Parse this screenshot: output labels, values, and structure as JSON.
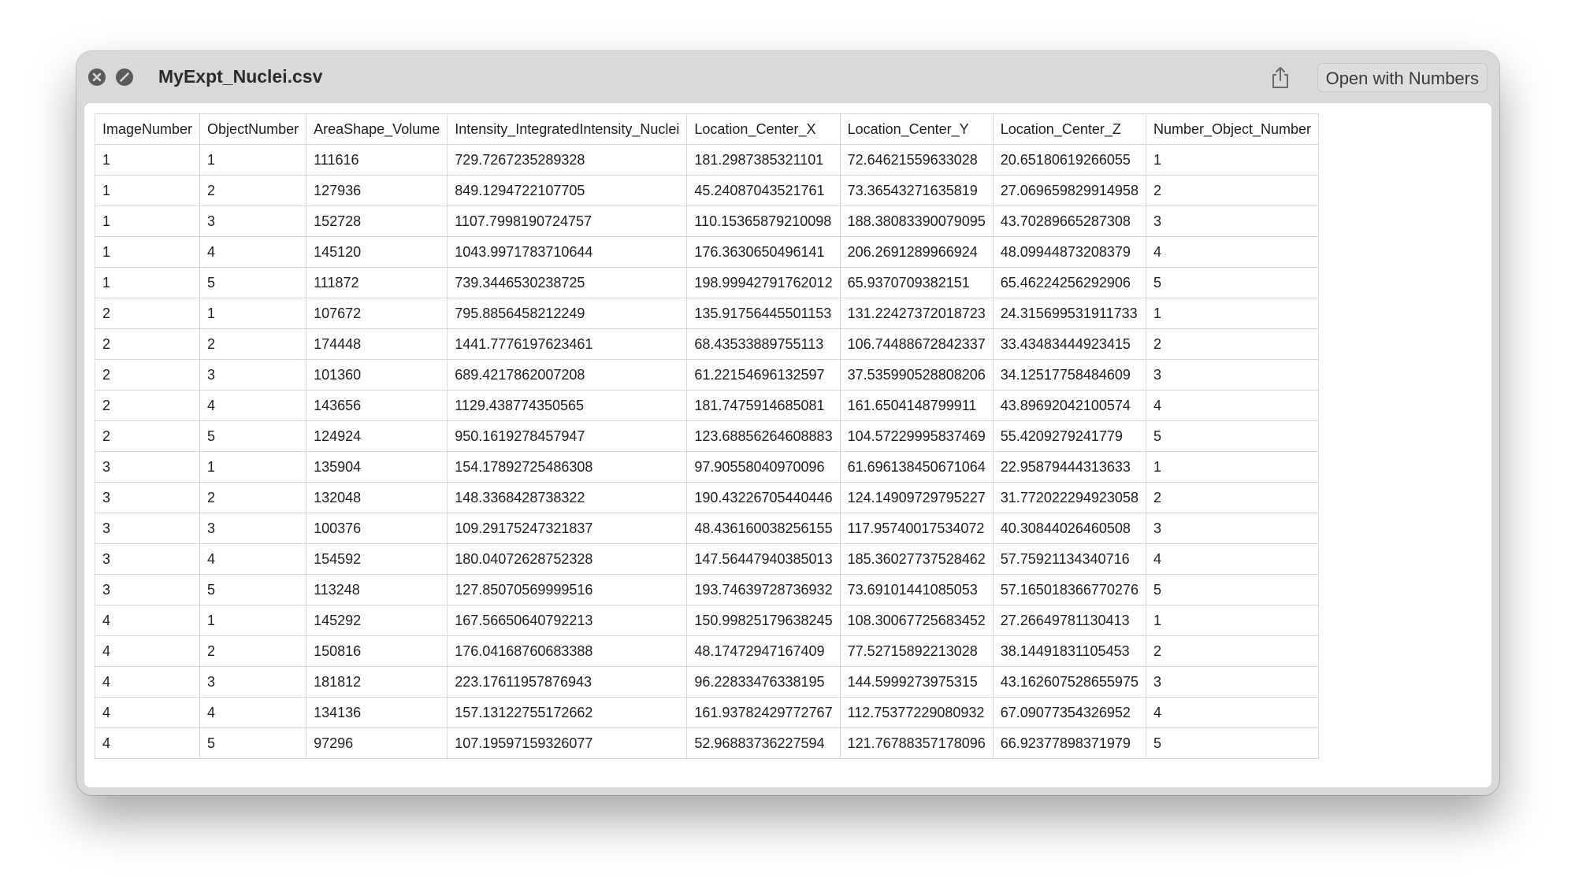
{
  "window": {
    "title": "MyExpt_Nuclei.csv",
    "open_button_label": "Open with Numbers"
  },
  "table": {
    "columns": [
      "ImageNumber",
      "ObjectNumber",
      "AreaShape_Volume",
      "Intensity_IntegratedIntensity_Nuclei",
      "Location_Center_X",
      "Location_Center_Y",
      "Location_Center_Z",
      "Number_Object_Number"
    ],
    "rows": [
      [
        "1",
        "1",
        "111616",
        "729.7267235289328",
        "181.2987385321101",
        "72.64621559633028",
        "20.65180619266055",
        "1"
      ],
      [
        "1",
        "2",
        "127936",
        "849.1294722107705",
        "45.24087043521761",
        "73.36543271635819",
        "27.069659829914958",
        "2"
      ],
      [
        "1",
        "3",
        "152728",
        "1107.7998190724757",
        "110.15365879210098",
        "188.38083390079095",
        "43.70289665287308",
        "3"
      ],
      [
        "1",
        "4",
        "145120",
        "1043.9971783710644",
        "176.3630650496141",
        "206.2691289966924",
        "48.09944873208379",
        "4"
      ],
      [
        "1",
        "5",
        "111872",
        "739.3446530238725",
        "198.99942791762012",
        "65.9370709382151",
        "65.46224256292906",
        "5"
      ],
      [
        "2",
        "1",
        "107672",
        "795.8856458212249",
        "135.91756445501153",
        "131.22427372018723",
        "24.315699531911733",
        "1"
      ],
      [
        "2",
        "2",
        "174448",
        "1441.7776197623461",
        "68.43533889755113",
        "106.74488672842337",
        "33.43483444923415",
        "2"
      ],
      [
        "2",
        "3",
        "101360",
        "689.4217862007208",
        "61.22154696132597",
        "37.535990528808206",
        "34.12517758484609",
        "3"
      ],
      [
        "2",
        "4",
        "143656",
        "1129.438774350565",
        "181.7475914685081",
        "161.6504148799911",
        "43.89692042100574",
        "4"
      ],
      [
        "2",
        "5",
        "124924",
        "950.1619278457947",
        "123.68856264608883",
        "104.57229995837469",
        "55.4209279241779",
        "5"
      ],
      [
        "3",
        "1",
        "135904",
        "154.17892725486308",
        "97.90558040970096",
        "61.696138450671064",
        "22.95879444313633",
        "1"
      ],
      [
        "3",
        "2",
        "132048",
        "148.3368428738322",
        "190.43226705440446",
        "124.14909729795227",
        "31.772022294923058",
        "2"
      ],
      [
        "3",
        "3",
        "100376",
        "109.29175247321837",
        "48.436160038256155",
        "117.95740017534072",
        "40.30844026460508",
        "3"
      ],
      [
        "3",
        "4",
        "154592",
        "180.04072628752328",
        "147.56447940385013",
        "185.36027737528462",
        "57.75921134340716",
        "4"
      ],
      [
        "3",
        "5",
        "113248",
        "127.85070569999516",
        "193.74639728736932",
        "73.69101441085053",
        "57.165018366770276",
        "5"
      ],
      [
        "4",
        "1",
        "145292",
        "167.56650640792213",
        "150.99825179638245",
        "108.30067725683452",
        "27.26649781130413",
        "1"
      ],
      [
        "4",
        "2",
        "150816",
        "176.04168760683388",
        "48.17472947167409",
        "77.52715892213028",
        "38.14491831105453",
        "2"
      ],
      [
        "4",
        "3",
        "181812",
        "223.17611957876943",
        "96.22833476338195",
        "144.5999273975315",
        "43.162607528655975",
        "3"
      ],
      [
        "4",
        "4",
        "134136",
        "157.13122755172662",
        "161.93782429772767",
        "112.75377229080932",
        "67.09077354326952",
        "4"
      ],
      [
        "4",
        "5",
        "97296",
        "107.19597159326077",
        "52.96883736227594",
        "121.76788357178096",
        "66.92377898371979",
        "5"
      ]
    ]
  },
  "icons": {
    "close": "close-icon",
    "fullscreen": "fullscreen-icon",
    "share": "share-icon"
  },
  "colors": {
    "titlebar": "#d9d9d9",
    "traffic_light": "#5b5b5b",
    "grid_border": "#d6d6d6"
  }
}
